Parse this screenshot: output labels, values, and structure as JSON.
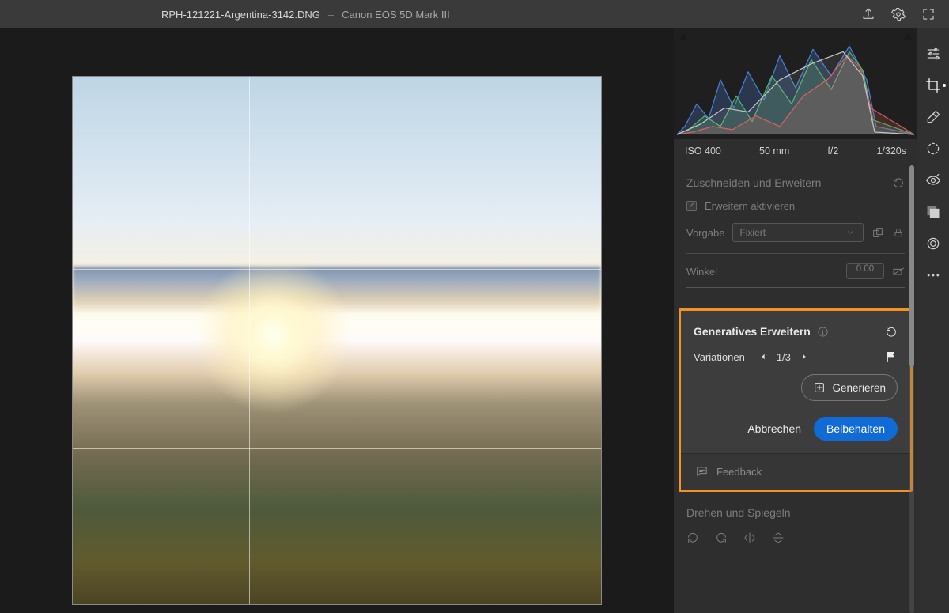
{
  "header": {
    "filename": "RPH-121221-Argentina-3142.DNG",
    "separator": "–",
    "camera": "Canon EOS 5D Mark III"
  },
  "meta": {
    "iso": "ISO 400",
    "focal": "50 mm",
    "aperture": "f/2",
    "shutter": "1/320s"
  },
  "crop": {
    "title": "Zuschneiden und Erweitern",
    "enable_expand_label": "Erweitern aktivieren",
    "preset_label": "Vorgabe",
    "preset_value": "Fixiert",
    "angle_label": "Winkel",
    "angle_value": "0.00"
  },
  "gen": {
    "title": "Generatives Erweitern",
    "variations_label": "Variationen",
    "variations_value": "1/3",
    "generate_label": "Generieren",
    "cancel_label": "Abbrechen",
    "keep_label": "Beibehalten",
    "feedback_label": "Feedback"
  },
  "rotate": {
    "title": "Drehen und Spiegeln"
  }
}
